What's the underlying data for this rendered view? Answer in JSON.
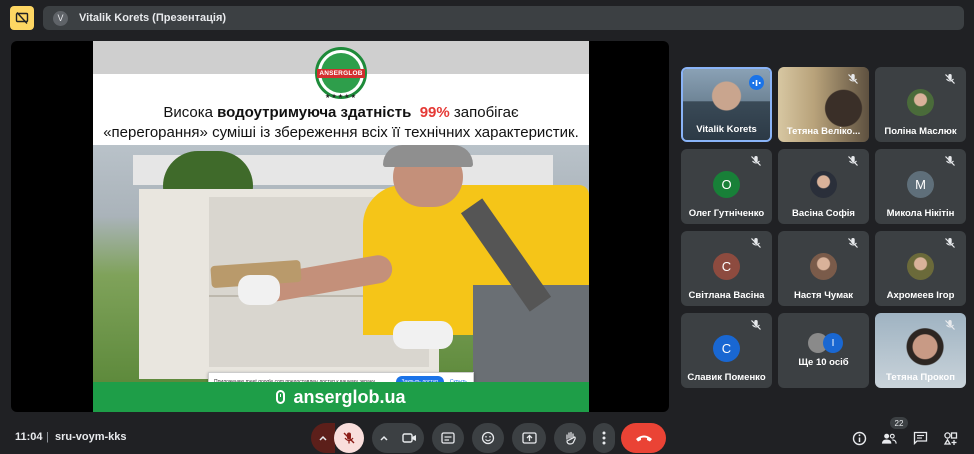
{
  "header": {
    "presenter_initial": "V",
    "title": "Vitalik Korets (Презентація)"
  },
  "slide": {
    "logo_text": "ANSERGLOB",
    "logo_stars": "★★★★★",
    "headline_line1_pre": "Висока ",
    "headline_line1_bold": "водоутримуюча здатність",
    "headline_line1_red": "99%",
    "headline_line1_post": " запобігає",
    "headline_line2": "«перегорання» суміші із збереження всіх її технічних характеристик.",
    "footer": "anserglob.ua",
    "share_notice": "Приложению meet.google.com предоставлен доступ к вашему экрану.",
    "share_button": "Закрыть доступ",
    "share_hide": "Скрыть"
  },
  "participants": [
    {
      "name": "Vitalik Korets",
      "type": "video",
      "speaking": true
    },
    {
      "name": "Тетяна Веліко...",
      "type": "video",
      "muted": true
    },
    {
      "name": "Поліна Маслюк",
      "type": "photo",
      "muted": true,
      "color": "#4a6b3a"
    },
    {
      "name": "Олег Гутніченко",
      "type": "initial",
      "initial": "О",
      "color": "#188038",
      "muted": true
    },
    {
      "name": "Васіна Софія",
      "type": "photo",
      "muted": true,
      "color": "#2a2f3a"
    },
    {
      "name": "Микола Нікітін",
      "type": "initial",
      "initial": "М",
      "color": "#5f6f7a",
      "muted": true
    },
    {
      "name": "Світлана Васіна",
      "type": "initial",
      "initial": "С",
      "color": "#8d4b3f",
      "muted": true
    },
    {
      "name": "Настя Чумак",
      "type": "photo",
      "muted": true,
      "color": "#7a5b4a"
    },
    {
      "name": "Ахромеев Ігор",
      "type": "photo",
      "muted": true,
      "color": "#6b6a3a"
    },
    {
      "name": "Славик Поменко",
      "type": "initial",
      "initial": "С",
      "color": "#1967d2",
      "muted": true
    },
    {
      "name": "Ще 10 осіб",
      "type": "more",
      "initial": "І"
    },
    {
      "name": "Тетяна Прокоп",
      "type": "video",
      "muted": true
    }
  ],
  "bottom": {
    "time": "11:04",
    "separator": "|",
    "meeting_code": "sru-voym-kks",
    "people_count": "22"
  },
  "colors": {
    "background": "#202124",
    "tile": "#3c4043",
    "end_call": "#ea4335",
    "brand_green": "#1e9e48",
    "accent_blue": "#8ab4f8"
  }
}
